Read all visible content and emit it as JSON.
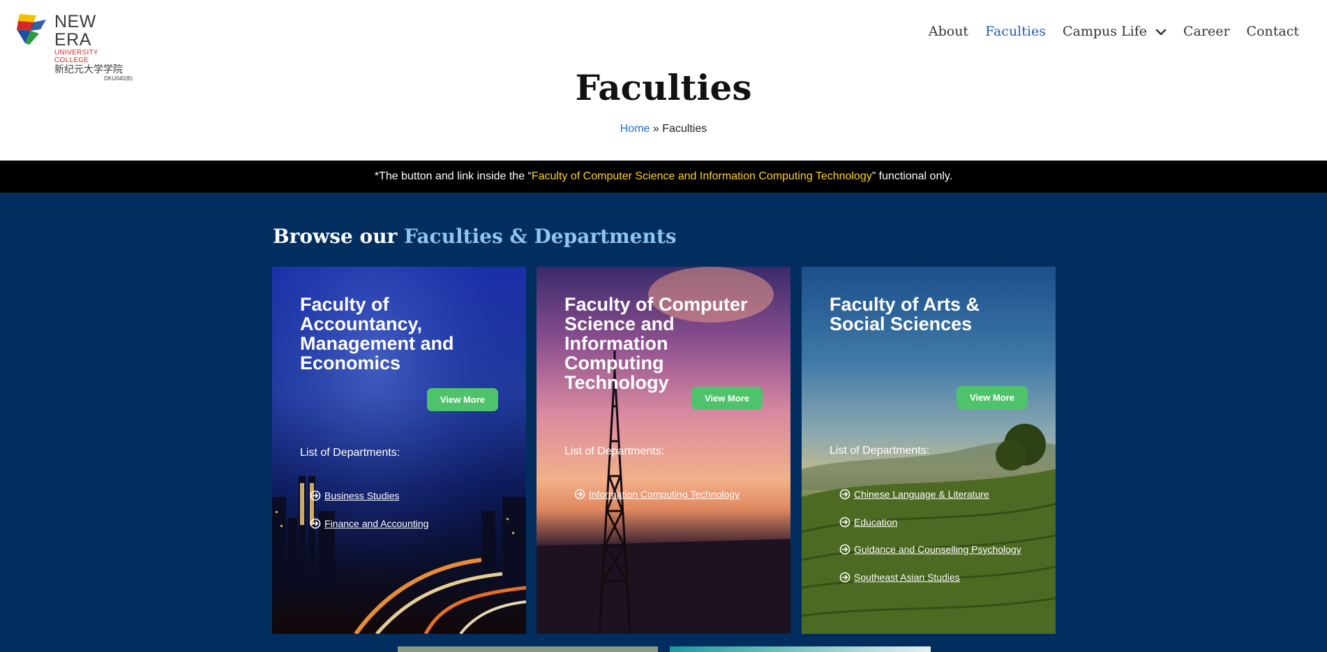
{
  "logo": {
    "name": "NEW ERA",
    "subtitle": "UNIVERSITY COLLEGE",
    "chinese": "新纪元大学学院",
    "code": "DKU040(B)"
  },
  "nav": {
    "items": [
      {
        "label": "About"
      },
      {
        "label": "Faculties"
      },
      {
        "label": "Campus Life"
      },
      {
        "label": "Career"
      },
      {
        "label": "Contact"
      }
    ]
  },
  "page": {
    "title": "Faculties",
    "breadcrumb_home": "Home",
    "breadcrumb_sep": " » ",
    "breadcrumb_current": "Faculties"
  },
  "notice": {
    "prefix": "*The button and link inside the “",
    "highlight": "Faculty of Computer Science and Information Computing Technology",
    "suffix": "” functional only."
  },
  "browse": {
    "lead": "Browse our ",
    "accent": "Faculties & Departments"
  },
  "cards": [
    {
      "title": "Faculty of Accountancy, Management and Economics",
      "button": "View More",
      "dept_label": "List of Departments:",
      "departments": [
        "Business Studies",
        "Finance and Accounting"
      ]
    },
    {
      "title": "Faculty of Computer Science and Information Computing Technology",
      "button": "View More",
      "dept_label": "List of Departments:",
      "departments": [
        "Information Computing Technology"
      ]
    },
    {
      "title": "Faculty of Arts & Social Sciences",
      "button": "View More",
      "dept_label": "List of Departments:",
      "departments": [
        "Chinese Language & Literature",
        "Education",
        "Guidance and Counselling Psychology",
        "Southeast Asian Studies"
      ]
    }
  ],
  "colors": {
    "nav_active": "#1f5fbf",
    "notice_highlight": "#ffd21c",
    "main_bg": "#012e5f",
    "browse_accent": "#8fc6ee",
    "button": "#4fc36b"
  },
  "icons": {
    "dept_bullet": "arrow-circle-right-icon",
    "dropdown": "chevron-down-icon"
  }
}
